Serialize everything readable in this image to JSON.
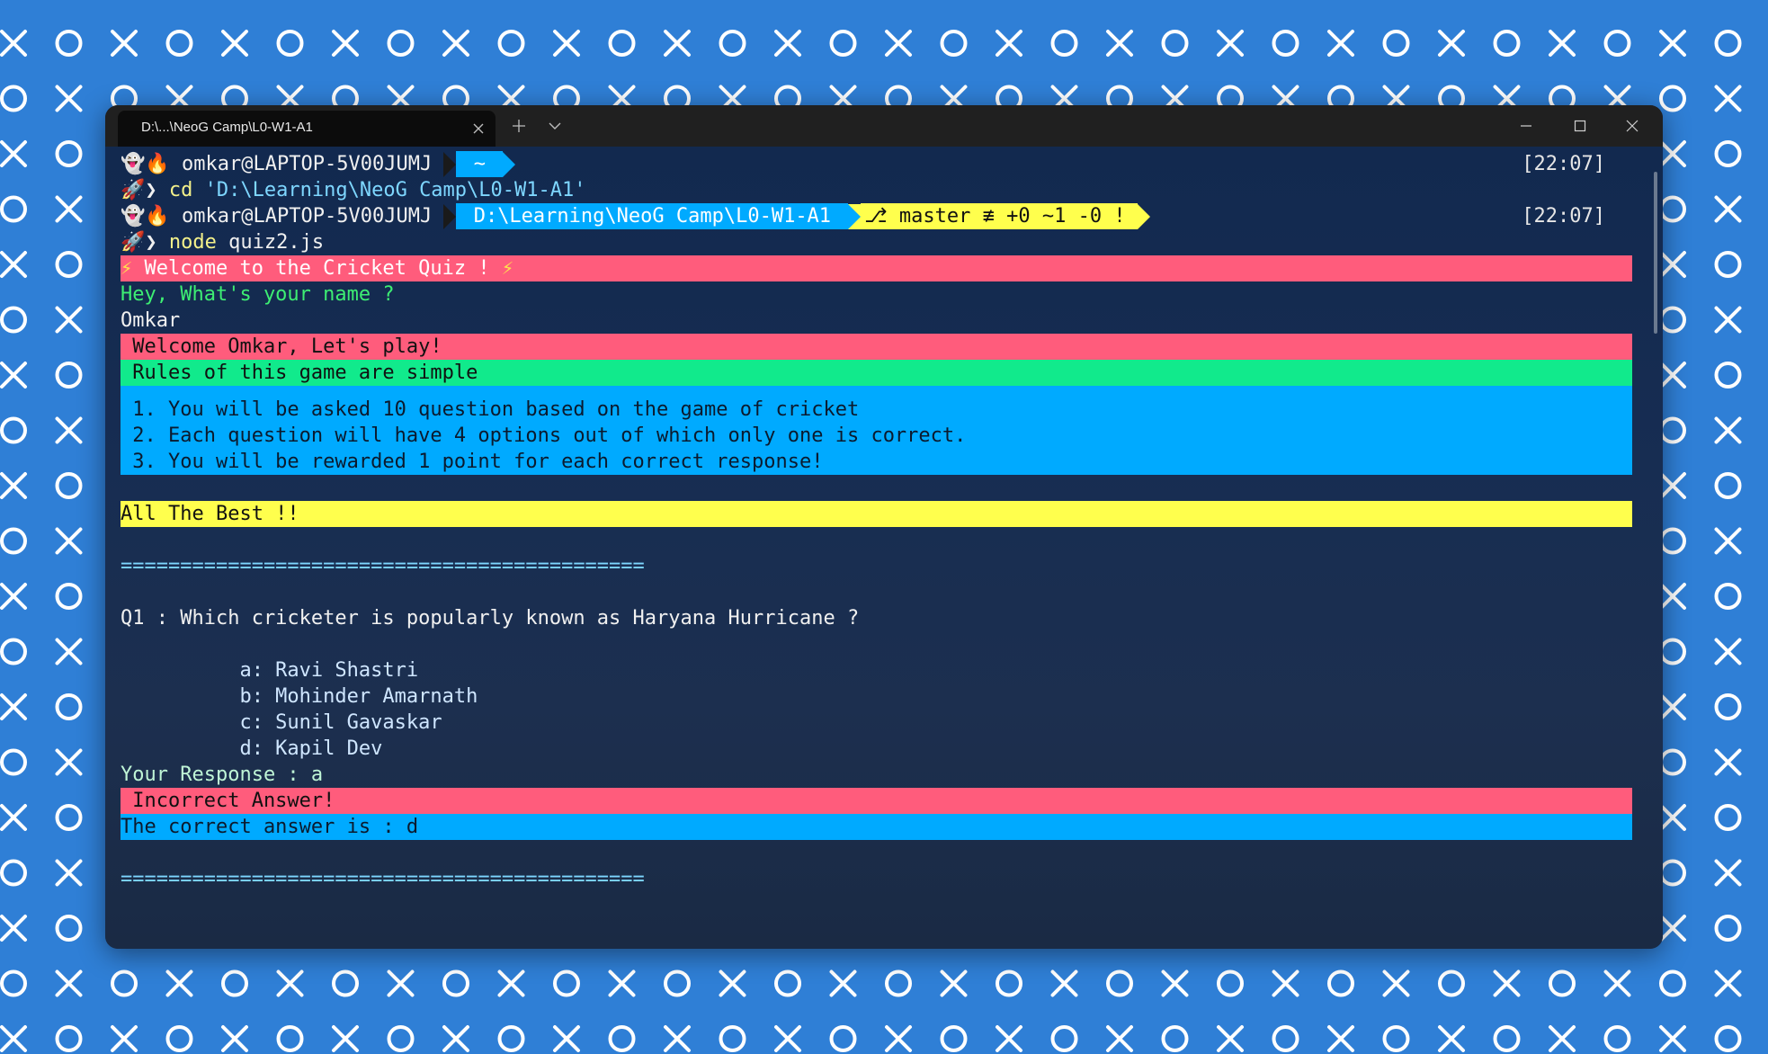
{
  "window": {
    "tab_title": "D:\\...\\NeoG Camp\\L0-W1-A1"
  },
  "colors": {
    "background": "#2f7fd6",
    "pink": "#ff5c7c",
    "green": "#11ea8c",
    "blue": "#00aaff",
    "yellow": "#ffff4d"
  },
  "prompt1": {
    "user": " omkar@LAPTOP-5V00JUMJ ",
    "path": " ~ ",
    "time": "[22:07]"
  },
  "cmd1": {
    "cmd": "cd",
    "arg": " 'D:\\Learning\\NeoG Camp\\L0-W1-A1'"
  },
  "prompt2": {
    "user": " omkar@LAPTOP-5V00JUMJ ",
    "path": " D:\\Learning\\NeoG Camp\\L0-W1-A1 ",
    "git": " master ≢ +0 ~1 -0 ! ",
    "time": "[22:07]"
  },
  "cmd2": {
    "cmd": "node",
    "arg": " quiz2.js"
  },
  "output": {
    "welcome": " Welcome to the Cricket Quiz ! ",
    "ask_name": "Hey, What's your name ?",
    "name": "Omkar",
    "greet": " Welcome Omkar, Let's play!",
    "rules_title": " Rules of this game are simple",
    "rules": [
      " 1. You will be asked 10 question based on the game of cricket",
      " 2. Each question will have 4 options out of which only one is correct.",
      " 3. You will be rewarded 1 point for each correct response!"
    ],
    "best": "All The Best !!",
    "separator1": "============================================",
    "question": "Q1 : Which cricketer is popularly known as Haryana Hurricane ?",
    "options": [
      "          a: Ravi Shastri",
      "          b: Mohinder Amarnath",
      "          c: Sunil Gavaskar",
      "          d: Kapil Dev"
    ],
    "response": "Your Response : a",
    "incorrect": " Incorrect Answer!",
    "correct_is": "The correct answer is : d",
    "separator2": "============================================"
  }
}
